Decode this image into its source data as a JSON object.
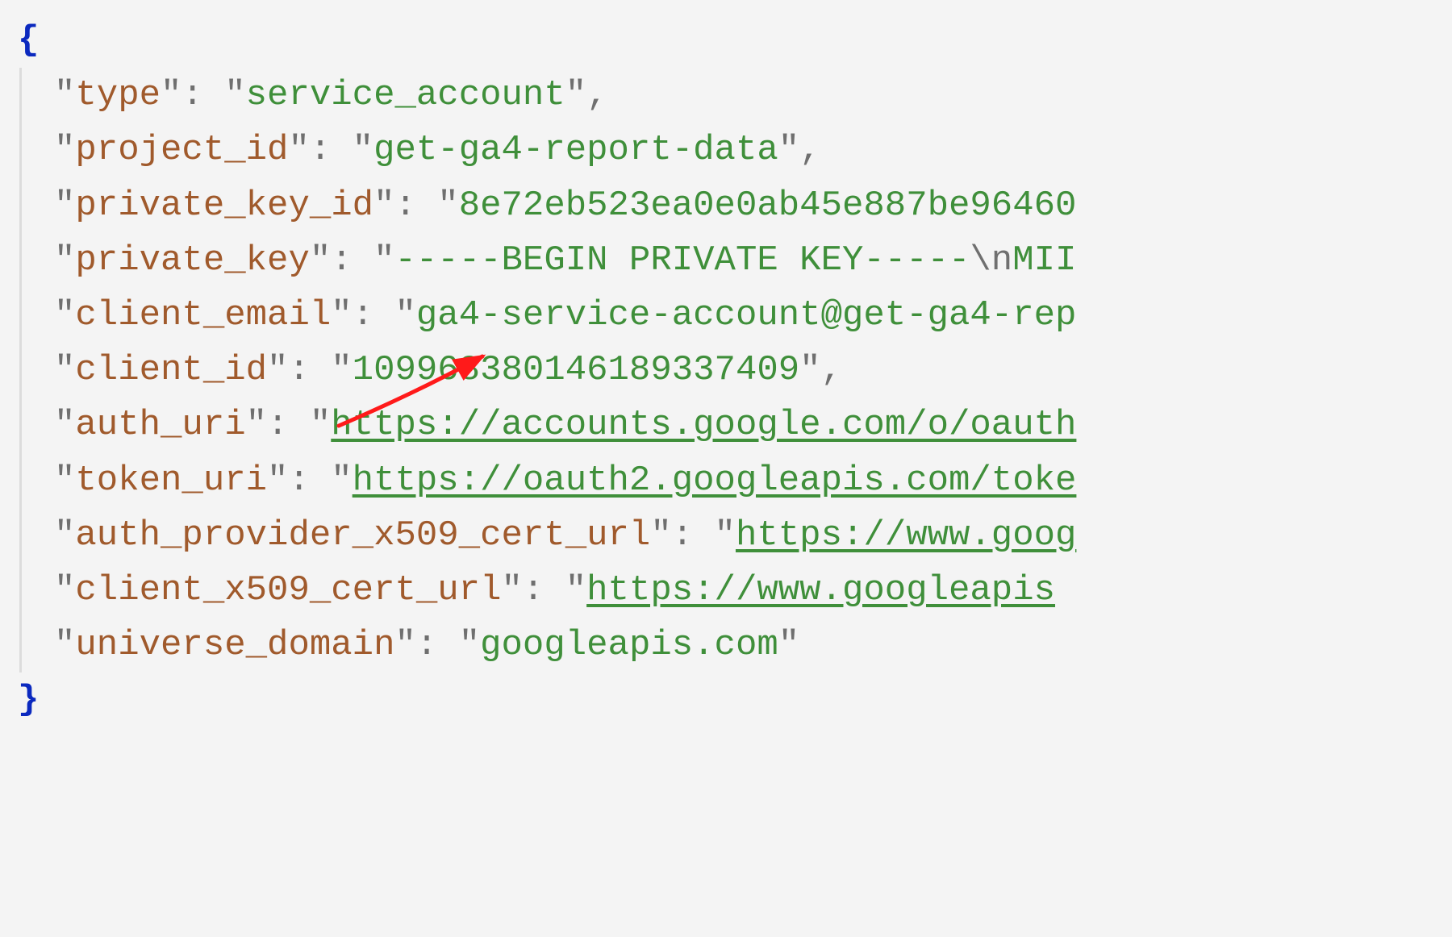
{
  "json": {
    "open": "{",
    "close": "}",
    "keys": {
      "type": "type",
      "project_id": "project_id",
      "private_key_id": "private_key_id",
      "private_key": "private_key",
      "client_email": "client_email",
      "client_id": "client_id",
      "auth_uri": "auth_uri",
      "token_uri": "token_uri",
      "auth_provider_x509_cert_url": "auth_provider_x509_cert_url",
      "client_x509_cert_url": "client_x509_cert_url",
      "universe_domain": "universe_domain"
    },
    "values": {
      "type": "service_account",
      "project_id": "get-ga4-report-data",
      "private_key_id": "8e72eb523ea0e0ab45e887be96460",
      "private_key_prefix": "-----BEGIN PRIVATE KEY-----",
      "private_key_escape": "\\n",
      "private_key_suffix": "MII",
      "client_email": "ga4-service-account@get-ga4-rep",
      "client_id": "109968380146189337409",
      "auth_uri": "https://accounts.google.com/o/oauth",
      "token_uri": "https://oauth2.googleapis.com/toke",
      "auth_provider_x509_cert_url": "https://www.goog",
      "client_x509_cert_url": "https://www.googleapis",
      "universe_domain": "googleapis.com"
    }
  },
  "annotation": {
    "type": "arrow",
    "points_to": "client_email value",
    "color": "#ff0000"
  }
}
